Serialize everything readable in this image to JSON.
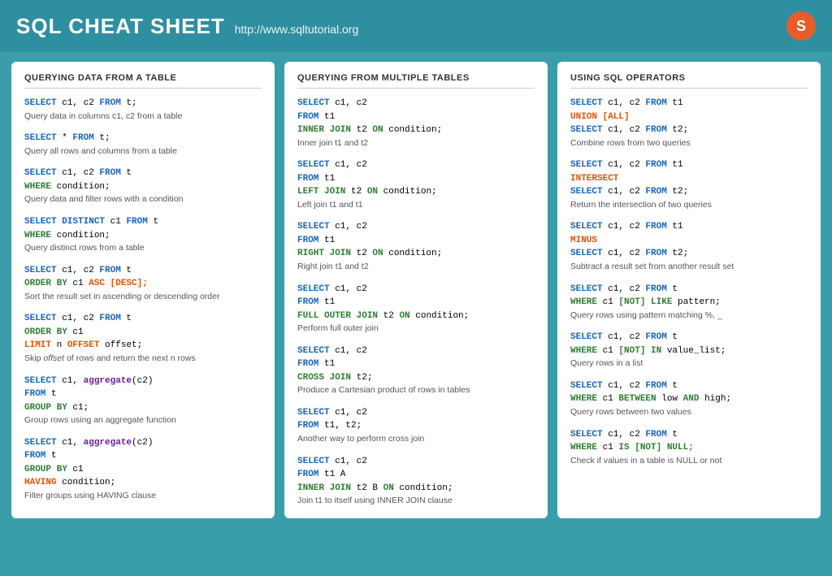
{
  "header": {
    "title": "SQL CHEAT SHEET",
    "url": "http://www.sqltutorial.org",
    "logo": "S"
  },
  "columns": [
    {
      "title": "QUERYING DATA FROM A TABLE",
      "sections": [
        {
          "code": [
            "SELECT c1, c2 FROM t;"
          ],
          "desc": "Query data in columns c1, c2 from a table"
        },
        {
          "code": [
            "SELECT * FROM t;"
          ],
          "desc": "Query all rows and columns from a table"
        },
        {
          "code": [
            "SELECT c1, c2 FROM t",
            "WHERE condition;"
          ],
          "desc": "Query data and filter rows with a condition"
        },
        {
          "code": [
            "SELECT DISTINCT c1 FROM t",
            "WHERE condition;"
          ],
          "desc": "Query distinct rows from a table"
        },
        {
          "code": [
            "SELECT c1, c2 FROM t",
            "ORDER BY c1 ASC [DESC];"
          ],
          "desc": "Sort the result set in ascending or descending order"
        },
        {
          "code": [
            "SELECT c1, c2 FROM t",
            "ORDER BY c1",
            "LIMIT n OFFSET offset;"
          ],
          "desc": "Skip offset of rows and return the next n rows"
        },
        {
          "code": [
            "SELECT c1, aggregate(c2)",
            "FROM t",
            "GROUP BY c1;"
          ],
          "desc": "Group rows using an aggregate function"
        },
        {
          "code": [
            "SELECT c1, aggregate(c2)",
            "FROM t",
            "GROUP BY c1",
            "HAVING condition;"
          ],
          "desc": "Filter groups using HAVING clause"
        }
      ]
    },
    {
      "title": "QUERYING FROM MULTIPLE TABLES",
      "sections": [
        {
          "code": [
            "SELECT c1, c2",
            "FROM t1",
            "INNER JOIN t2 ON condition;"
          ],
          "desc": "Inner join t1 and t2"
        },
        {
          "code": [
            "SELECT c1, c2",
            "FROM t1",
            "LEFT JOIN t2 ON condition;"
          ],
          "desc": "Left join t1 and t1"
        },
        {
          "code": [
            "SELECT c1, c2",
            "FROM t1",
            "RIGHT JOIN t2 ON condition;"
          ],
          "desc": "Right join t1 and t2"
        },
        {
          "code": [
            "SELECT c1, c2",
            "FROM t1",
            "FULL OUTER JOIN t2 ON condition;"
          ],
          "desc": "Perform full outer join"
        },
        {
          "code": [
            "SELECT c1, c2",
            "FROM t1",
            "CROSS JOIN t2;"
          ],
          "desc": "Produce a Cartesian product of rows in tables"
        },
        {
          "code": [
            "SELECT c1, c2",
            "FROM t1, t2;"
          ],
          "desc": "Another way to perform cross join"
        },
        {
          "code": [
            "SELECT c1, c2",
            "FROM t1 A",
            "INNER JOIN t2 B ON condition;"
          ],
          "desc": "Join t1 to itself using INNER JOIN clause"
        }
      ]
    },
    {
      "title": "USING SQL OPERATORS",
      "sections": [
        {
          "code": [
            "SELECT c1, c2 FROM t1",
            "UNION [ALL]",
            "SELECT c1, c2 FROM t2;"
          ],
          "desc": "Combine rows from two queries"
        },
        {
          "code": [
            "SELECT c1, c2 FROM t1",
            "INTERSECT",
            "SELECT c1, c2 FROM t2;"
          ],
          "desc": "Return the intersection of two queries"
        },
        {
          "code": [
            "SELECT c1, c2 FROM t1",
            "MINUS",
            "SELECT c1, c2 FROM t2;"
          ],
          "desc": "Subtract a result set from another result set"
        },
        {
          "code": [
            "SELECT c1, c2 FROM t",
            "WHERE c1 [NOT] LIKE pattern;"
          ],
          "desc": "Query rows using pattern matching %, _"
        },
        {
          "code": [
            "SELECT c1, c2 FROM t",
            "WHERE c1 [NOT] IN value_list;"
          ],
          "desc": "Query rows in a list"
        },
        {
          "code": [
            "SELECT c1, c2 FROM t",
            "WHERE c1 BETWEEN low AND high;"
          ],
          "desc": "Query rows between two values"
        },
        {
          "code": [
            "SELECT c1, c2 FROM t",
            "WHERE c1 IS [NOT] NULL;"
          ],
          "desc": "Check if values in a table is NULL or not"
        }
      ]
    }
  ]
}
